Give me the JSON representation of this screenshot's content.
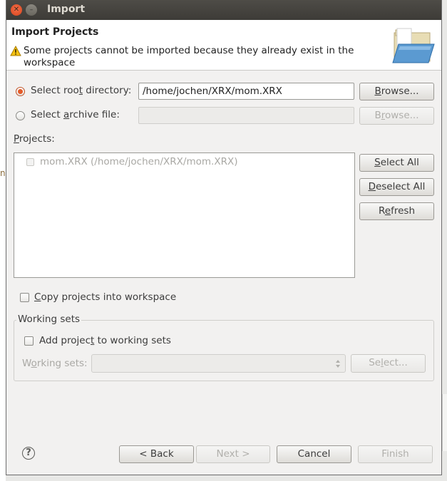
{
  "window": {
    "title": "Import"
  },
  "header": {
    "title": "Import Projects",
    "message": "Some projects cannot be imported because they already exist in the workspace"
  },
  "source": {
    "root_label": "Select root directory:",
    "root_value": "/home/jochen/XRX/mom.XRX",
    "archive_label": "Select archive file:",
    "archive_value": "",
    "browse_label": "Browse..."
  },
  "projects": {
    "label": "Projects:",
    "items": [
      {
        "label": "mom.XRX (/home/jochen/XRX/mom.XRX)",
        "checked": false,
        "enabled": false
      }
    ],
    "select_all": "Select All",
    "deselect_all": "Deselect All",
    "refresh": "Refresh"
  },
  "options": {
    "copy_label": "Copy projects into workspace",
    "copy_checked": false
  },
  "working_sets": {
    "group_label": "Working sets",
    "add_label": "Add project to working sets",
    "add_checked": false,
    "sets_label": "Working sets:",
    "sets_value": "",
    "select_label": "Select..."
  },
  "footer": {
    "back": "< Back",
    "next": "Next >",
    "cancel": "Cancel",
    "finish": "Finish"
  },
  "icons": {
    "close": "close-icon",
    "minimize": "minimize-icon",
    "warning": "warning-icon",
    "folder": "open-folder-icon",
    "help": "help-icon",
    "spinner": "spinner-arrows-icon"
  },
  "colors": {
    "titlebar": "#3d3b37",
    "radio_selected": "#e45b2a",
    "window_bg": "#f2f1f0"
  }
}
